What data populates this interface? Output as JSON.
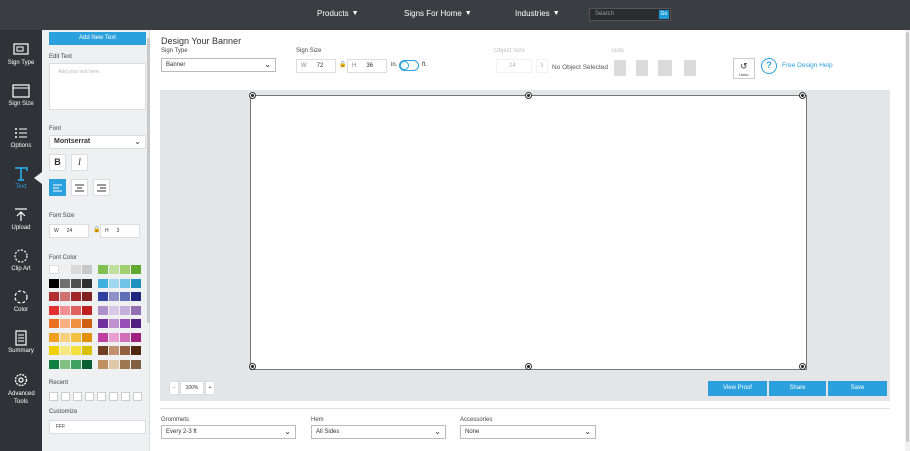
{
  "topnav": {
    "items": [
      "Products",
      "Signs For Home",
      "Industries"
    ],
    "search_placeholder": "Search",
    "search_go": "Go"
  },
  "leftrail": {
    "items": [
      {
        "label": "Sign Type",
        "icon": "sign-type-icon"
      },
      {
        "label": "Sign Size",
        "icon": "sign-size-icon"
      },
      {
        "label": "Options",
        "icon": "options-list-icon"
      },
      {
        "label": "Text",
        "icon": "text-t-icon",
        "active": true
      },
      {
        "label": "Upload",
        "icon": "upload-icon"
      },
      {
        "label": "Clip Art",
        "icon": "clip-art-icon"
      },
      {
        "label": "Color",
        "icon": "color-icon"
      },
      {
        "label": "Summary",
        "icon": "summary-icon"
      },
      {
        "label": "Advanced Tools",
        "icon": "gear-icon"
      }
    ]
  },
  "textpanel": {
    "add_button": "Add New Text",
    "edit_label": "Edit Text",
    "edit_placeholder": "Add your text here.",
    "font_label": "Font",
    "font_value": "Montserrat",
    "font_size_label": "Font Size",
    "width_label": "W",
    "width_value": "24",
    "height_label": "H",
    "height_value": "3",
    "font_color_label": "Font Color",
    "recent_label": "Recent",
    "customize_label": "Customize",
    "custom_value": "FFF",
    "palette_left": [
      [
        "#ffffff",
        "#f0f0f0",
        "#d9d9d9",
        "#c8c8c8"
      ],
      [
        "#000000",
        "#707070",
        "#505050",
        "#303030"
      ],
      [
        "#b03030",
        "#d07070",
        "#a02828",
        "#802020"
      ],
      [
        "#e03030",
        "#f09090",
        "#e06060",
        "#c02020"
      ],
      [
        "#e87020",
        "#f8b080",
        "#f09040",
        "#d06010"
      ],
      [
        "#f0a020",
        "#f8d080",
        "#f4c040",
        "#e09000"
      ],
      [
        "#f0d000",
        "#f8e880",
        "#f4e040",
        "#d8c000"
      ],
      [
        "#108040",
        "#80c080",
        "#40a060",
        "#086030"
      ]
    ],
    "palette_right": [
      [
        "#80c050",
        "#c0e0a0",
        "#a0d070",
        "#60a830"
      ],
      [
        "#40b0e0",
        "#a0d8f0",
        "#70c4e8",
        "#2090c0"
      ],
      [
        "#3040a0",
        "#9090c8",
        "#6070b8",
        "#202880"
      ],
      [
        "#b090c8",
        "#d8c8e8",
        "#c4b0dc",
        "#9070b0"
      ],
      [
        "#7030a0",
        "#c090d0",
        "#9850b8",
        "#502080"
      ],
      [
        "#c040a0",
        "#e8a0d0",
        "#d070b8",
        "#a02080"
      ],
      [
        "#704020",
        "#c09070",
        "#906040",
        "#502810"
      ],
      [
        "#c09060",
        "#e0c8a8",
        "#a07850",
        "#806040"
      ]
    ]
  },
  "design": {
    "title": "Design Your Banner",
    "sign_type_label": "Sign Type",
    "sign_type_value": "Banner",
    "sign_size_label": "Sign Size",
    "size_w_label": "W",
    "size_w_value": "72",
    "size_h_label": "H",
    "size_h_value": "36",
    "unit_in": "in.",
    "unit_ft": "ft.",
    "object_size_label": "Object Size",
    "object_w": "24",
    "object_h": "3",
    "no_object": "No Object Selected",
    "tools_label": "Tools",
    "undo_label": "Undo",
    "help_label": "Free Design Help"
  },
  "canvas": {
    "zoom_minus": "-",
    "zoom_value": "100%",
    "zoom_plus": "+",
    "view_proof": "View Proof",
    "share": "Share",
    "save": "Save"
  },
  "options": {
    "grommets_label": "Grommets",
    "grommets_value": "Every 2-3 ft",
    "hem_label": "Hem",
    "hem_value": "All Sides",
    "accessories_label": "Accessories",
    "accessories_value": "None"
  }
}
